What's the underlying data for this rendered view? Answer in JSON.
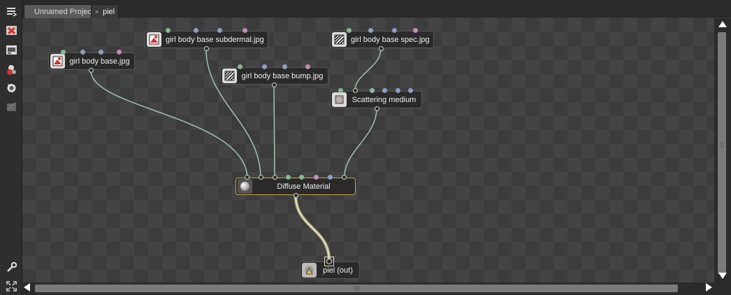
{
  "tabs": [
    {
      "label": "Unnamed Project"
    },
    {
      "label": "piel",
      "close": "×"
    }
  ],
  "nodes": {
    "girl_body_base": {
      "label": "girl body base.jpg",
      "icon": "image-texture-icon"
    },
    "subdermal": {
      "label": "girl body base subdermal.jpg",
      "icon": "image-texture-icon"
    },
    "bump": {
      "label": "girl body base bump.jpg",
      "icon": "greyscale-texture-icon"
    },
    "spec": {
      "label": "girl body base spec.jpg",
      "icon": "greyscale-texture-icon"
    },
    "scattering": {
      "label": "Scattering medium",
      "icon": "medium-icon"
    },
    "diffuse": {
      "label": "Diffuse Material",
      "icon": "material-sphere-icon"
    },
    "output": {
      "label": "piel (out)",
      "icon": "material-output-icon"
    }
  },
  "pin_colors": {
    "green": "#86b88f",
    "blue": "#8aa0c4",
    "pink": "#c48abd",
    "teal": "#8cb6a8"
  },
  "wire_colors": {
    "link": "#9ec4b4",
    "selected": "#d8cfa0"
  },
  "toolbar": [
    {
      "icon": "load-icon"
    },
    {
      "icon": "unload-icon"
    },
    {
      "icon": "render-target-icon"
    },
    {
      "icon": "materials-icon"
    },
    {
      "icon": "environment-icon"
    },
    {
      "icon": "settings-disabled-icon"
    },
    {
      "icon": "wrench-icon"
    },
    {
      "icon": "fullscreen-icon"
    }
  ]
}
